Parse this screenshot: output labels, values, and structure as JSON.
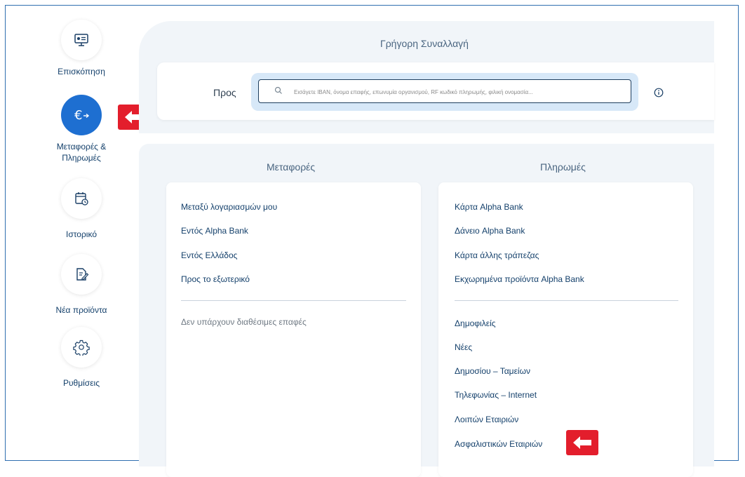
{
  "sidebar": {
    "items": [
      {
        "label": "Επισκόπηση",
        "icon": "monitor-icon"
      },
      {
        "label": "Μεταφορές & Πληρωμές",
        "icon": "euro-transfer-icon",
        "active": true
      },
      {
        "label": "Ιστορικό",
        "icon": "calendar-clock-icon"
      },
      {
        "label": "Νέα προϊόντα",
        "icon": "document-edit-icon"
      },
      {
        "label": "Ρυθμίσεις",
        "icon": "gear-icon"
      }
    ]
  },
  "quick_transaction": {
    "title": "Γρήγορη Συναλλαγή",
    "to_label": "Προς",
    "search_placeholder": "Εισάγετε IBAN, όνομα επαφής, επωνυμία οργανισμού, RF κωδικό πληρωμής, φιλική ονομασία..."
  },
  "transfers": {
    "title": "Μεταφορές",
    "links": [
      "Μεταξύ λογαριασμών μου",
      "Εντός Alpha Bank",
      "Εντός Ελλάδος",
      "Προς το εξωτερικό"
    ],
    "empty_contacts": "Δεν υπάρχουν διαθέσιμες επαφές"
  },
  "payments": {
    "title": "Πληρωμές",
    "links": [
      "Κάρτα Alpha Bank",
      "Δάνειο Alpha Bank",
      "Κάρτα άλλης τράπεζας",
      "Εκχωρημένα προϊόντα Alpha Bank"
    ],
    "categories": [
      "Δημοφιλείς",
      "Νέες",
      "Δημοσίου – Ταμείων",
      "Τηλεφωνίας – Internet",
      "Λοιπών Εταιριών",
      "Ασφαλιστικών Εταιριών"
    ]
  },
  "colors": {
    "accent": "#1e6fd1",
    "text_dark": "#14406b",
    "highlight_arrow": "#e31e2c",
    "panel_bg": "#f1f5f9"
  }
}
